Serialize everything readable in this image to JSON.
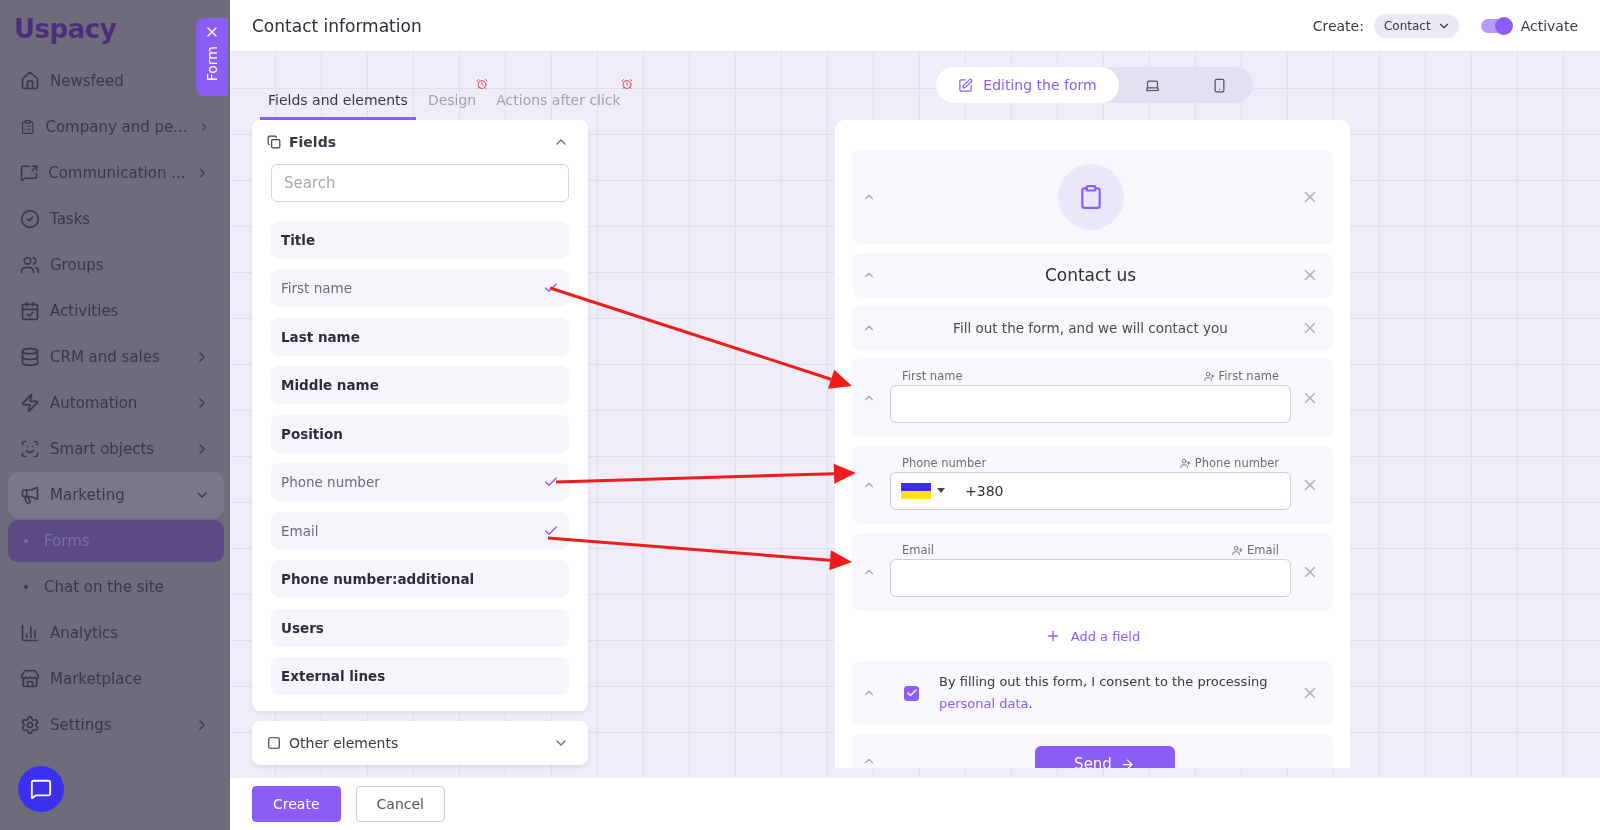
{
  "sidebar": {
    "logo": "Uspacy",
    "items": [
      {
        "label": "Newsfeed",
        "submenu": false,
        "expanded": false,
        "selected": false
      },
      {
        "label": "Company and pe...",
        "submenu": true,
        "expanded": false,
        "selected": false
      },
      {
        "label": "Communication ...",
        "submenu": true,
        "expanded": false,
        "selected": false
      },
      {
        "label": "Tasks",
        "submenu": false,
        "expanded": false,
        "selected": false
      },
      {
        "label": "Groups",
        "submenu": false,
        "expanded": false,
        "selected": false
      },
      {
        "label": "Activities",
        "submenu": false,
        "expanded": false,
        "selected": false
      },
      {
        "label": "CRM and sales",
        "submenu": true,
        "expanded": false,
        "selected": false
      },
      {
        "label": "Automation",
        "submenu": true,
        "expanded": false,
        "selected": false
      },
      {
        "label": "Smart objects",
        "submenu": true,
        "expanded": false,
        "selected": false
      },
      {
        "label": "Marketing",
        "submenu": true,
        "expanded": true,
        "selected": false,
        "children": [
          {
            "label": "Forms",
            "selected": true
          },
          {
            "label": "Chat on the site",
            "selected": false
          }
        ]
      },
      {
        "label": "Analytics",
        "submenu": false,
        "expanded": false,
        "selected": false
      },
      {
        "label": "Marketplace",
        "submenu": false,
        "expanded": false,
        "selected": false
      },
      {
        "label": "Settings",
        "submenu": true,
        "expanded": false,
        "selected": false
      }
    ]
  },
  "drawer_tab": {
    "label": "Form"
  },
  "header": {
    "title": "Contact information",
    "create_label": "Create:",
    "create_value": "Contact",
    "activate": {
      "label": "Activate",
      "on": true
    }
  },
  "tabs": [
    {
      "label": "Fields and elements",
      "selected": true,
      "alert": false
    },
    {
      "label": "Design",
      "selected": false,
      "alert": true
    },
    {
      "label": "Actions after click",
      "selected": false,
      "alert": true
    }
  ],
  "view_switch": [
    {
      "kind": "edit",
      "label": "Editing the form",
      "selected": true
    },
    {
      "kind": "desktop",
      "selected": false
    },
    {
      "kind": "mobile",
      "selected": false
    }
  ],
  "fields_panel": {
    "title": "Fields",
    "expanded": true,
    "search_placeholder": "Search",
    "items": [
      {
        "label": "Title",
        "checked": false
      },
      {
        "label": "First name",
        "checked": true
      },
      {
        "label": "Last name",
        "checked": false
      },
      {
        "label": "Middle name",
        "checked": false
      },
      {
        "label": "Position",
        "checked": false
      },
      {
        "label": "Phone number",
        "checked": true
      },
      {
        "label": "Email",
        "checked": true
      },
      {
        "label": "Phone number:additional",
        "checked": false
      },
      {
        "label": "Users",
        "checked": false
      },
      {
        "label": "External lines",
        "checked": false
      }
    ]
  },
  "other_panel": {
    "title": "Other elements",
    "expanded": false
  },
  "form_preview": {
    "blocks": [
      {
        "kind": "icon"
      },
      {
        "kind": "heading",
        "text": "Contact us"
      },
      {
        "kind": "text",
        "text": "Fill out the form, and we will contact you"
      },
      {
        "kind": "field",
        "label": "First name",
        "mapping": "First name"
      },
      {
        "kind": "phone",
        "label": "Phone number",
        "mapping": "Phone number",
        "value": "+380"
      },
      {
        "kind": "field",
        "label": "Email",
        "mapping": "Email"
      },
      {
        "kind": "add",
        "label": "Add a field"
      },
      {
        "kind": "consent",
        "checked": true,
        "text": "By filling out this form, I consent to the processing",
        "link": "personal data",
        "after": "."
      },
      {
        "kind": "button",
        "label": "Send"
      }
    ]
  },
  "footer": {
    "buttons": [
      {
        "label": "Create",
        "kind": "primary"
      },
      {
        "label": "Cancel",
        "kind": "secondary"
      }
    ]
  }
}
